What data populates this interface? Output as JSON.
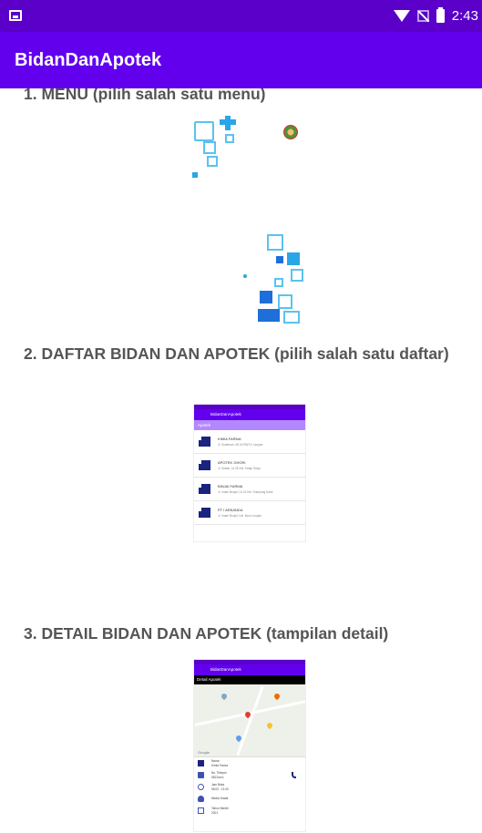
{
  "status_bar": {
    "time": "2:43",
    "icons": [
      "image-icon",
      "wifi-icon",
      "no-sim-icon",
      "battery-icon"
    ]
  },
  "app_bar": {
    "title": "BidanDanApotek"
  },
  "sections": [
    {
      "title": "1. MENU (pilih salah satu menu)"
    },
    {
      "title": "2. DAFTAR BIDAN DAN APOTEK (pilih salah satu daftar)"
    },
    {
      "title": "3. DETAIL BIDAN DAN APOTEK (tampilan detail)"
    }
  ],
  "list_shot": {
    "appbar_title": "BidanDanApotek",
    "subbar_title": "Apotek",
    "items": [
      {
        "name": "KIMIA FARMA",
        "address": "Jl. Sudirman, 08 04 RW 01 Lkupan"
      },
      {
        "name": "APOTEK GHORI",
        "address": "Jl. Sultan, Lk 05 Kel. Kelap Sulyo"
      },
      {
        "name": "BINJAI FARMA",
        "address": "Jl. Imam Bonjol, Lk 01 Kel. Sumpang Kahir"
      },
      {
        "name": "PT I ARKANDA",
        "address": "Jl. Imam Bonjol, Kel. Beru Lkupan"
      }
    ]
  },
  "detail_shot": {
    "appbar_title": "BidanDanApotek",
    "detail_bar": "Detail Apotek",
    "map_label": "Google",
    "info_rows": [
      {
        "icon": "building-icon",
        "label": "Nama",
        "value": "Kimia Farma"
      },
      {
        "icon": "contact-icon",
        "label": "No. Telepon",
        "value": "0812xxxx"
      },
      {
        "icon": "clock-icon",
        "label": "Jam Buka",
        "value": "08.00 - 21.00"
      },
      {
        "icon": "doctor-icon",
        "label": "Media Sosial",
        "value": ""
      },
      {
        "icon": "calendar-icon",
        "label": "Tahun Berdiri",
        "value": "2001"
      }
    ]
  },
  "colors": {
    "status": "#5a00c8",
    "primary": "#6200ee",
    "accent": "#29a6e8",
    "section_text": "#555555"
  }
}
